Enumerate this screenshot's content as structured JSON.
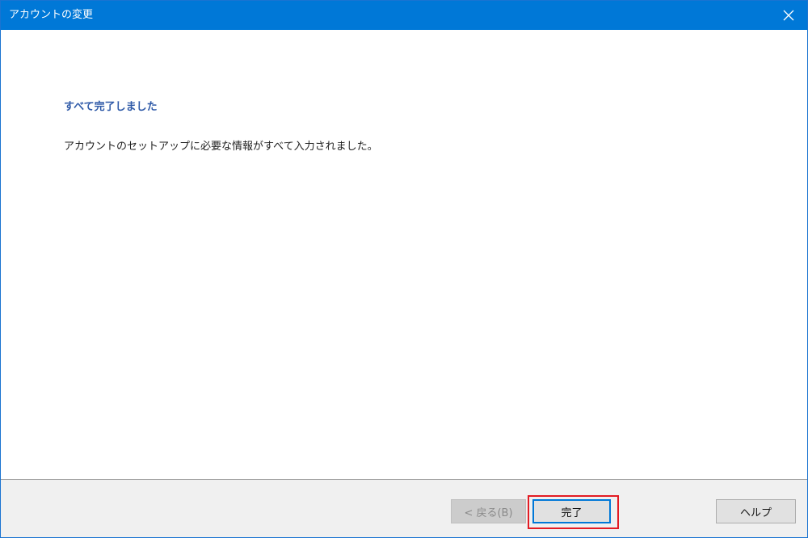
{
  "window": {
    "title": "アカウントの変更",
    "close_icon": "close-icon",
    "accent_color": "#0078d7"
  },
  "content": {
    "heading": "すべて完了しました",
    "message": "アカウントのセットアップに必要な情報がすべて入力されました。"
  },
  "footer": {
    "back_label": "< 戻る(B)",
    "finish_label": "完了",
    "help_label": "ヘルプ",
    "highlight_color": "#e31b23"
  }
}
